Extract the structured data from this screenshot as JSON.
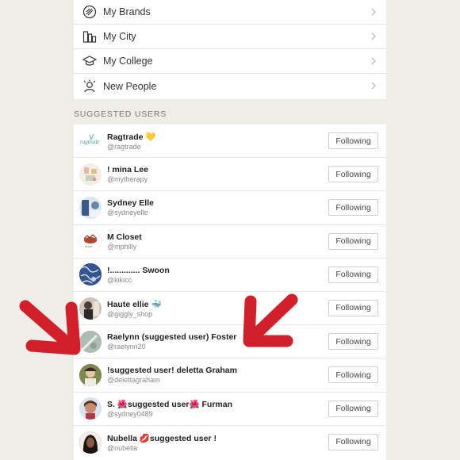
{
  "menu": [
    {
      "label": "My Brands",
      "icon": "brand-tag-icon"
    },
    {
      "label": "My City",
      "icon": "city-buildings-icon"
    },
    {
      "label": "My College",
      "icon": "graduation-cap-icon"
    },
    {
      "label": "New People",
      "icon": "new-person-icon"
    }
  ],
  "section_title": "SUGGESTED USERS",
  "users": [
    {
      "name": "Ragtrade 💛",
      "handle": "@ragtrade",
      "button": "Following"
    },
    {
      "name": "!    mina Lee",
      "handle": "@mytherapy",
      "button": "Following"
    },
    {
      "name": "Sydney Elle",
      "handle": "@sydneyelle",
      "button": "Following"
    },
    {
      "name": "M Closet",
      "handle": "@mphilly",
      "button": "Following"
    },
    {
      "name": "!............. Swoon",
      "handle": "@kikicc",
      "button": "Following"
    },
    {
      "name": "Haute ellie 🐳",
      "handle": "@giggly_shop",
      "button": "Following"
    },
    {
      "name": "Raelynn (suggested user) Foster",
      "handle": "@raelynn20",
      "button": "Following"
    },
    {
      "name": "!suggested user! deletta Graham",
      "handle": "@delettagraham",
      "button": "Following"
    },
    {
      "name": "S. 🌺suggested user🌺 Furman",
      "handle": "@sydney0489",
      "button": "Following"
    },
    {
      "name": "Nubella 💋suggested user !",
      "handle": "@nubella",
      "button": "Following"
    }
  ],
  "colors": {
    "arrow": "#d0202a",
    "background": "#eeede8"
  }
}
